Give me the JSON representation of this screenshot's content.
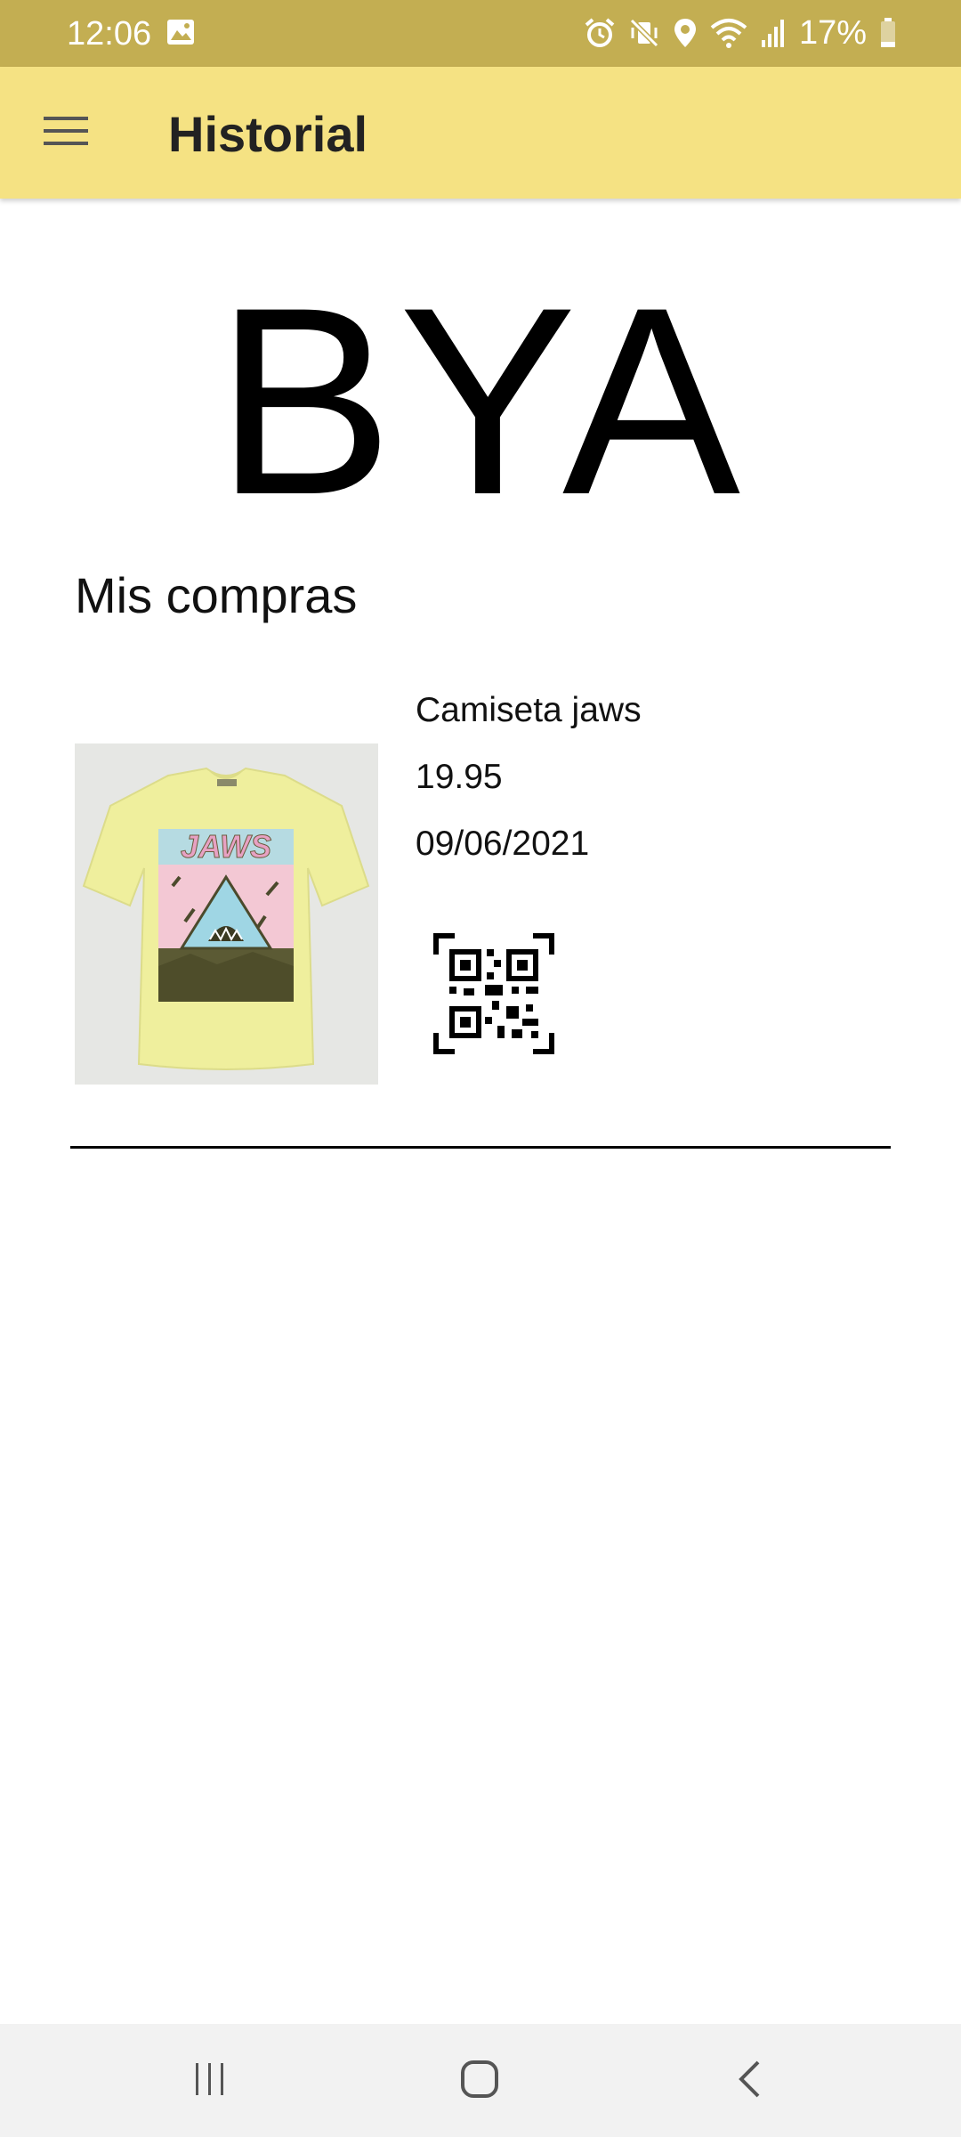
{
  "status_bar": {
    "time": "12:06",
    "battery_percent": "17%",
    "icons": [
      "image-icon",
      "alarm-icon",
      "vibrate-mute-icon",
      "location-icon",
      "wifi-icon",
      "signal-icon",
      "battery-icon"
    ]
  },
  "app_bar": {
    "title": "Historial",
    "menu_icon": "hamburger-menu-icon",
    "background": "#f5e283"
  },
  "logo": {
    "text": "BYA"
  },
  "section": {
    "title": "Mis compras"
  },
  "purchases": [
    {
      "name": "Camiseta jaws",
      "price": "19.95",
      "date": "09/06/2021",
      "image_icon": "tshirt-image",
      "qr_icon": "qr-code-icon"
    }
  ],
  "nav_bar": {
    "recents_icon": "recents-icon",
    "home_icon": "home-icon",
    "back_icon": "back-icon"
  },
  "colors": {
    "status_bar": "#c3ae52",
    "app_bar": "#f5e283",
    "nav_bar": "#f2f2f2"
  }
}
